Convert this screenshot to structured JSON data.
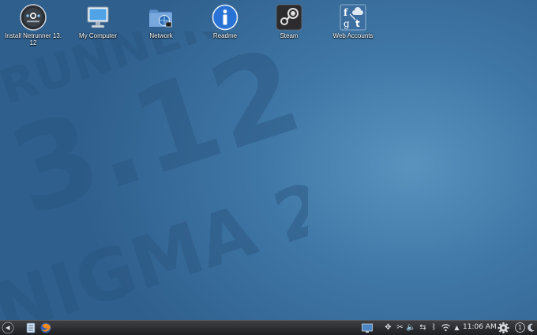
{
  "desktop": {
    "watermark": {
      "line1": "3.12",
      "line2": "NIGMA 2",
      "line3": "RUNNER"
    },
    "icons": [
      {
        "name": "install-netrunner",
        "label": "Install Netrunner 13.\n12",
        "icon": "install-disc-icon"
      },
      {
        "name": "my-computer",
        "label": "My Computer",
        "icon": "computer-monitor-icon"
      },
      {
        "name": "network",
        "label": "Network",
        "icon": "network-folder-icon"
      },
      {
        "name": "readme",
        "label": "Readme",
        "icon": "info-icon"
      },
      {
        "name": "steam",
        "label": "Steam",
        "icon": "steam-icon"
      },
      {
        "name": "web-accounts",
        "label": "Web Accounts",
        "icon": "web-accounts-icon"
      }
    ]
  },
  "taskbar": {
    "clock": "11:06 AM",
    "launchers": [
      "kickoff-menu-icon",
      "file-manager-icon",
      "firefox-icon"
    ],
    "tray": [
      "display-icon",
      "move-icon",
      "cut-icon",
      "volume-icon",
      "usb-icon",
      "bluetooth-icon",
      "wifi-icon",
      "arrow-up-icon",
      "gear-icon",
      "notification-icon",
      "moon-icon"
    ],
    "notification_count": "1"
  },
  "colors": {
    "desktop_center": "#5b93bf",
    "desktop_edge": "#2f5f8d",
    "taskbar": "#2a2c30"
  }
}
